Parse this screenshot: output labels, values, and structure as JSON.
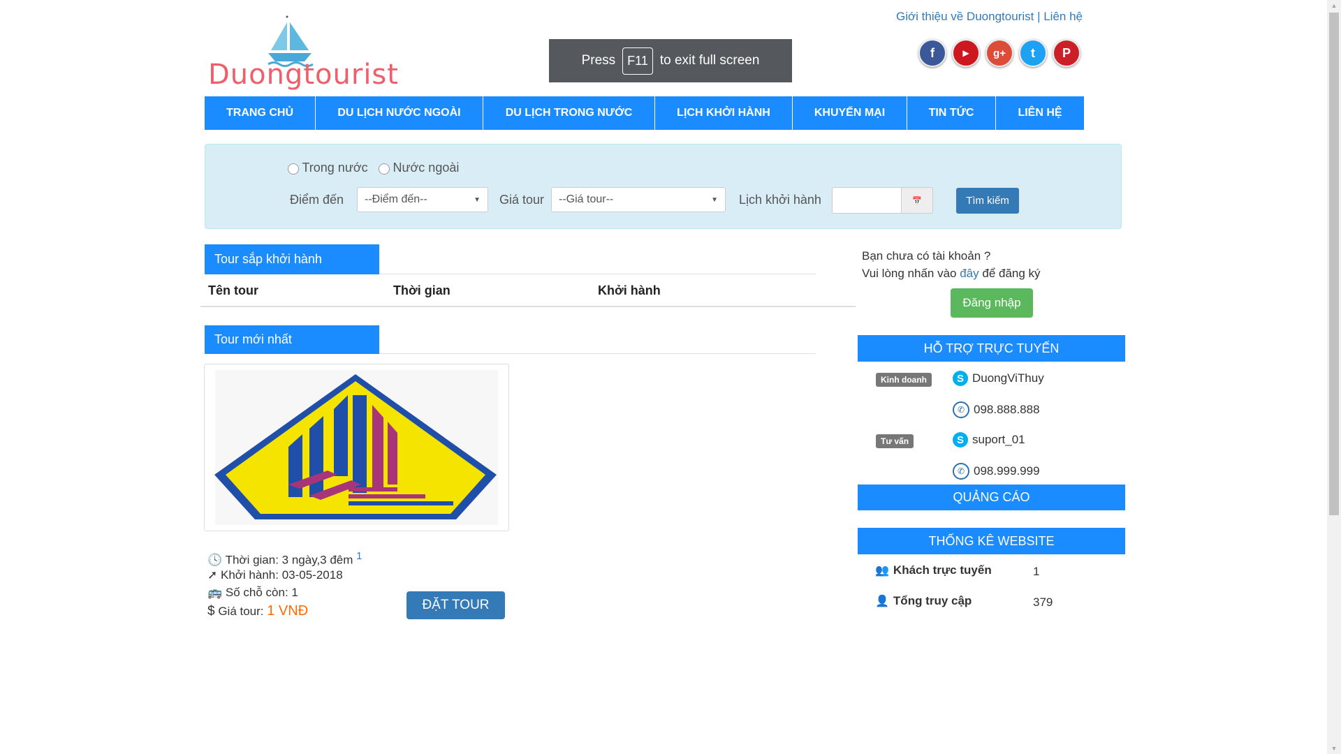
{
  "header": {
    "brand": "Duongtourist",
    "fullscreen_notice": {
      "before": "Press",
      "key": "F11",
      "after": "to exit full screen"
    },
    "top_links": {
      "about": "Giới thiệu về Duongtourist",
      "separator": "|",
      "contact": "Liên hệ"
    },
    "social": [
      {
        "icon": "facebook-icon",
        "glyph": "f",
        "color": "#3b5998"
      },
      {
        "icon": "youtube-icon",
        "glyph": "▶",
        "color": "#cc181e"
      },
      {
        "icon": "google-plus-icon",
        "glyph": "g+",
        "color": "#dd4b39"
      },
      {
        "icon": "twitter-icon",
        "glyph": "t",
        "color": "#1da1f2"
      },
      {
        "icon": "pinterest-icon",
        "glyph": "P",
        "color": "#cb2027"
      }
    ]
  },
  "nav": {
    "items": [
      {
        "label": "TRANG CHỦ"
      },
      {
        "label": "DU LỊCH NƯỚC NGOÀI"
      },
      {
        "label": "DU LỊCH TRONG NƯỚC"
      },
      {
        "label": "LỊCH KHỞI HÀNH"
      },
      {
        "label": "KHUYẾN MẠI"
      },
      {
        "label": "TIN TỨC"
      },
      {
        "label": "LIÊN HỆ"
      }
    ]
  },
  "search": {
    "radio_domestic": "Trong nước",
    "radio_foreign": "Nước ngoài",
    "destination_label": "Điểm đến",
    "destination_value": "--Điểm đến--",
    "price_label": "Giá tour",
    "price_value": "--Giá tour--",
    "schedule_label": "Lịch khởi hành",
    "schedule_value": "",
    "search_button": "Tìm kiếm"
  },
  "upcoming": {
    "title": "Tour sắp khởi hành",
    "columns": [
      "Tên tour",
      "Thời gian",
      "Khởi hành"
    ]
  },
  "latest": {
    "title": "Tour mới nhất",
    "tour": {
      "duration_label": "Thời gian: 3 ngày,3 đêm",
      "duration_count": "1",
      "departure": "Khởi hành: 03-05-2018",
      "seats": "Số chỗ còn: 1",
      "price_label": "Giá tour:",
      "price_value": "1 VNĐ",
      "book_button": "ĐẶT TOUR"
    }
  },
  "sidebar": {
    "account_line1": "Bạn chưa có tài khoản ?",
    "account_line2_before": "Vui lòng nhấn vào",
    "account_link": "đây",
    "account_line2_after": "để đăng ký",
    "login_button": "Đăng nhập",
    "support_title": "HỖ TRỢ TRỰC TUYẾN",
    "support": [
      {
        "badge": "Kinh doanh",
        "skype": "DuongViThuy",
        "phone": "098.888.888"
      },
      {
        "badge": "Tư vấn",
        "skype": "suport_01",
        "phone": "098.999.999"
      }
    ],
    "ads_title": "QUẢNG CÁO",
    "stats_title": "THỐNG KÊ WEBSITE",
    "stats": [
      {
        "label": "Khách trực tuyến",
        "value": "1"
      },
      {
        "label": "Tổng truy cập",
        "value": "379"
      }
    ]
  }
}
